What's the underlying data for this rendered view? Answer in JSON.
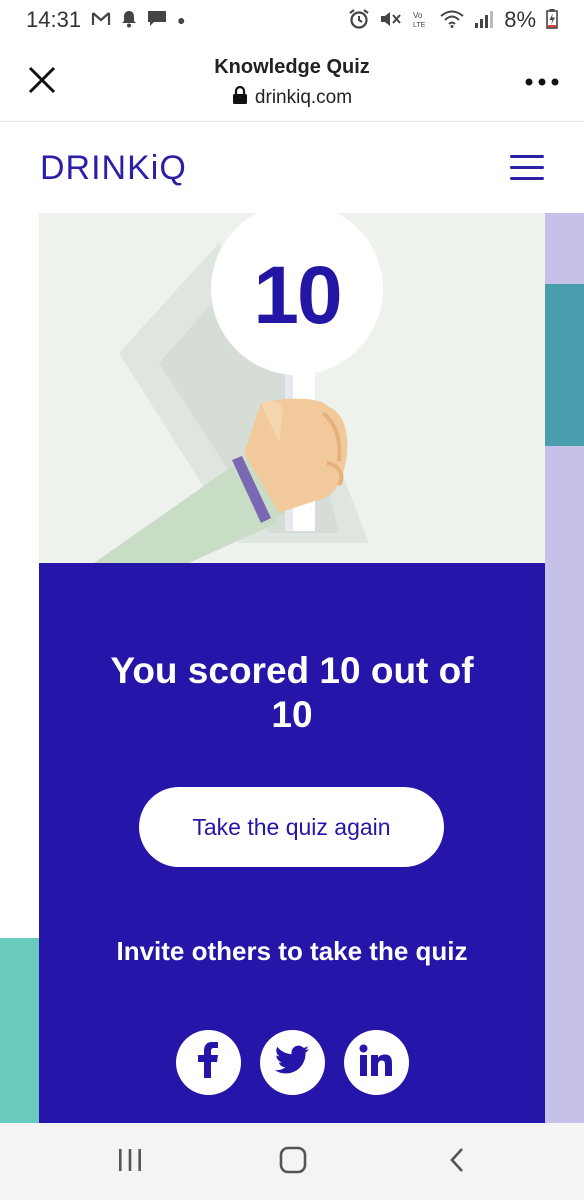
{
  "status_bar": {
    "time": "14:31",
    "battery_percent": "8%",
    "left_icons": [
      "gmail-icon",
      "notification-bell-icon",
      "chat-icon"
    ],
    "right_icons": [
      "alarm-icon",
      "mute-icon",
      "volte-icon",
      "wifi-icon",
      "signal-icon",
      "battery-charging-icon"
    ]
  },
  "browser": {
    "page_title": "Knowledge Quiz",
    "url": "drinkiq.com",
    "close_icon": "close-icon",
    "menu_icon": "more-icon"
  },
  "site": {
    "logo_text": "DRINKiQ",
    "menu_icon": "hamburger-icon",
    "brand_color": "#2515a8"
  },
  "hero": {
    "score_sign_value": "10"
  },
  "result": {
    "heading": "You scored 10 out of 10",
    "retake_button": "Take the quiz again",
    "invite_text": "Invite others to take the quiz",
    "share_buttons": [
      "facebook-icon",
      "twitter-icon",
      "linkedin-icon"
    ]
  },
  "nav_bar": {
    "buttons": [
      "recent-apps-icon",
      "home-icon",
      "back-icon"
    ]
  }
}
